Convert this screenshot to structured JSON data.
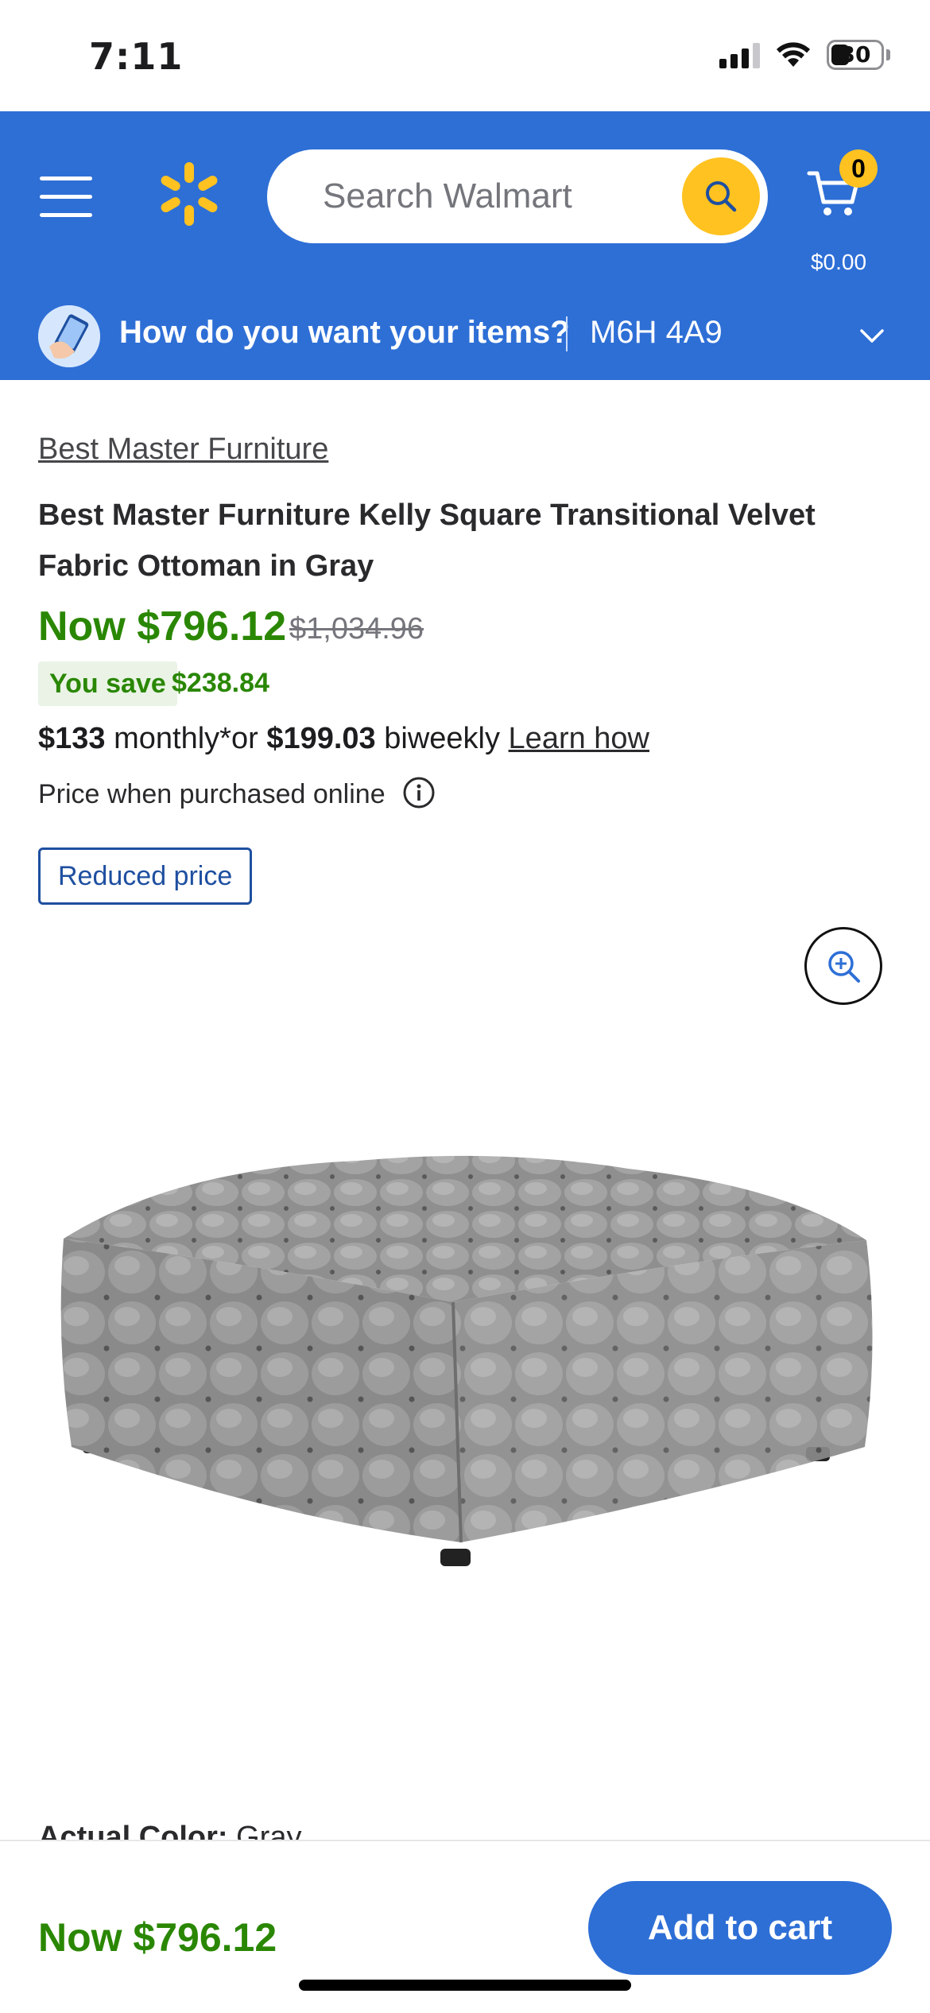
{
  "status_bar": {
    "time": "7:11",
    "battery": "30"
  },
  "header": {
    "search_placeholder": "Search Walmart",
    "cart_count": "0",
    "cart_total": "$0.00",
    "fulfillment_question": "How do you want your items?",
    "postal_code": "M6H 4A9",
    "brand_color": "#2e6fd6",
    "accent_color": "#ffc220"
  },
  "product": {
    "brand": "Best Master Furniture",
    "title": "Best Master Furniture Kelly Square Transitional Velvet Fabric Ottoman in Gray",
    "price_now": "Now $796.12",
    "price_was": "$1,034.96",
    "save_label": "You save",
    "save_amount": "$238.84",
    "monthly_amount": "$133",
    "monthly_label": "monthly*or",
    "biweekly_amount": "$199.03",
    "biweekly_label": "biweekly",
    "learn_how": "Learn how",
    "price_note": "Price when purchased online",
    "badge": "Reduced price",
    "actual_color_label": "Actual Color:",
    "actual_color_value": "Gray"
  },
  "bottom_bar": {
    "price": "Now $796.12",
    "add_to_cart": "Add to cart"
  },
  "icons": [
    "menu-icon",
    "walmart-spark-icon",
    "search-icon",
    "cart-icon",
    "fulfillment-icon",
    "chevron-down-icon",
    "info-icon",
    "zoom-in-icon"
  ]
}
